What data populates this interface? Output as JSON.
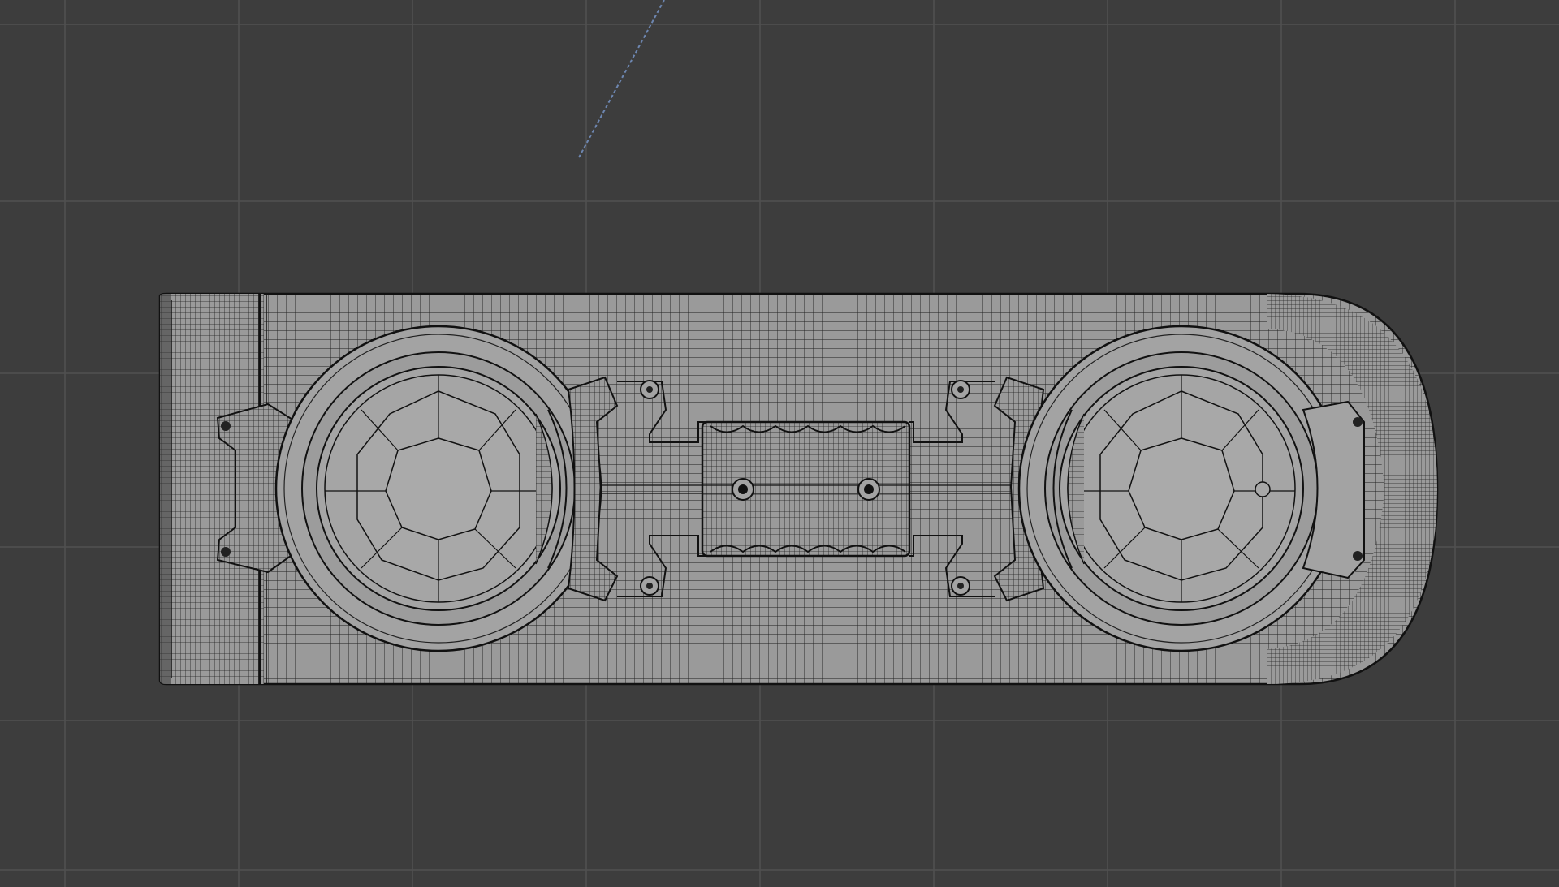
{
  "viewport": {
    "mode": "wireframe",
    "view": "top-orthographic",
    "background_color": "#3d3d3d",
    "grid_color": "#505050",
    "grid_visible": true,
    "object_line_color": "#1e1e1e",
    "object_fill_color": "#9b9b9b",
    "axis_line_color": "#6d86b0"
  },
  "object": {
    "name_hint": "speaker-mesh",
    "parts": [
      "main-body",
      "left-speaker-driver",
      "right-speaker-driver",
      "center-handle",
      "mount-tabs",
      "screw-holes"
    ]
  }
}
